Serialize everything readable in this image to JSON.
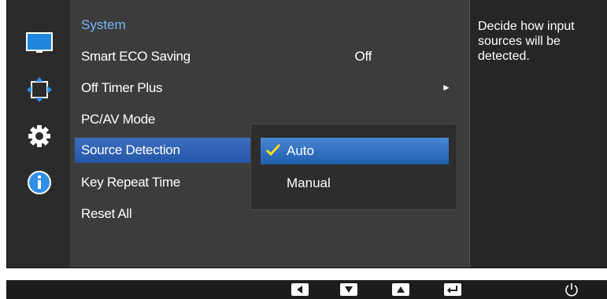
{
  "menu": {
    "title": "System",
    "items": [
      {
        "label": "Smart ECO Saving",
        "value": "Off"
      },
      {
        "label": "Off Timer Plus",
        "value": "►"
      },
      {
        "label": "PC/AV Mode",
        "value": ""
      },
      {
        "label": "Source Detection",
        "value": ""
      },
      {
        "label": "Key Repeat Time",
        "value": ""
      },
      {
        "label": "Reset All",
        "value": ""
      }
    ],
    "selected_item": "Source Detection"
  },
  "submenu": {
    "options": [
      {
        "label": "Auto",
        "checked": true
      },
      {
        "label": "Manual",
        "checked": false
      }
    ]
  },
  "help": {
    "text": "Decide how input sources will be detected."
  },
  "sidebar": {
    "icons": [
      "monitor-icon",
      "move-arrows-icon",
      "gear-icon",
      "info-icon"
    ]
  },
  "bottom_bar": {
    "buttons": [
      "left-arrow-icon",
      "down-arrow-icon",
      "up-arrow-icon",
      "enter-icon",
      "power-icon"
    ]
  },
  "colors": {
    "accent_text": "#7ab4f5",
    "selection": "#2456a8",
    "check": "#f5e11a"
  }
}
